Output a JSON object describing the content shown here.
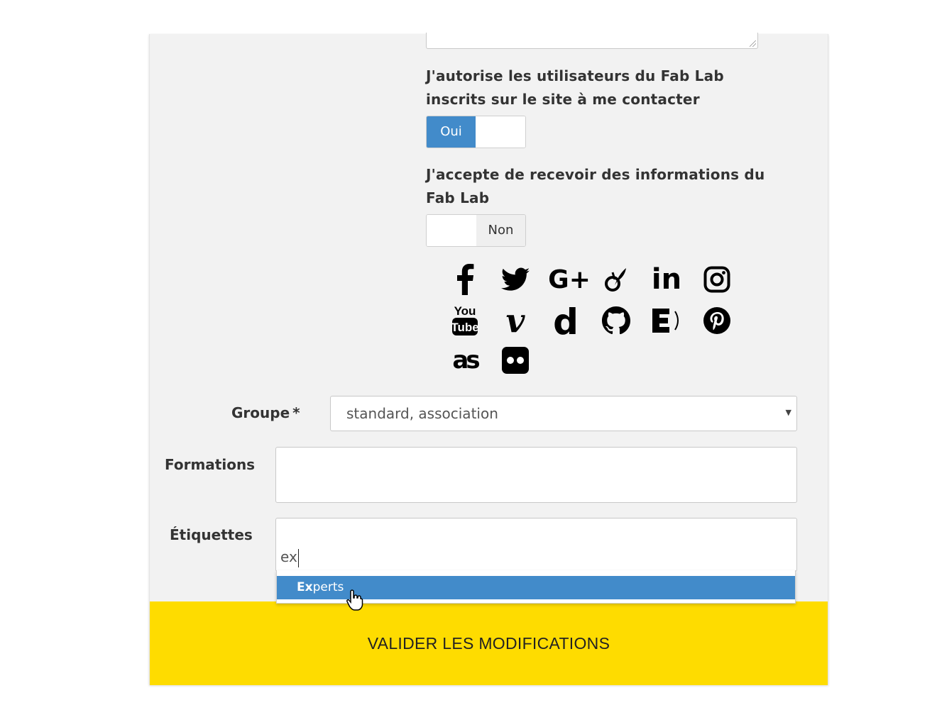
{
  "contact_consent": {
    "label": "J'autorise les utilisateurs du Fab Lab inscrits sur le site à me contacter",
    "value_label": "Oui"
  },
  "newsletter_consent": {
    "label": "J'accepte de recevoir des informations du Fab Lab",
    "value_label": "Non"
  },
  "social_icons": [
    "facebook-icon",
    "twitter-icon",
    "google-plus-icon",
    "viadeo-icon",
    "linkedin-icon",
    "instagram-icon",
    "youtube-icon",
    "vimeo-icon",
    "dailymotion-icon",
    "github-icon",
    "echosciences-icon",
    "pinterest-icon",
    "lastfm-icon",
    "flickr-icon"
  ],
  "group": {
    "label": "Groupe",
    "required_mark": "*",
    "value": "standard, association"
  },
  "trainings": {
    "label": "Formations",
    "value": ""
  },
  "tags": {
    "label": "Étiquettes",
    "typed_value": "ex",
    "suggestion_match": "Ex",
    "suggestion_rest": "perts"
  },
  "submit_label": "VALIDER LES MODIFICATIONS",
  "colors": {
    "accent": "#428bca",
    "submit_bg": "#fedc00",
    "panel_bg": "#f2f2f2"
  }
}
